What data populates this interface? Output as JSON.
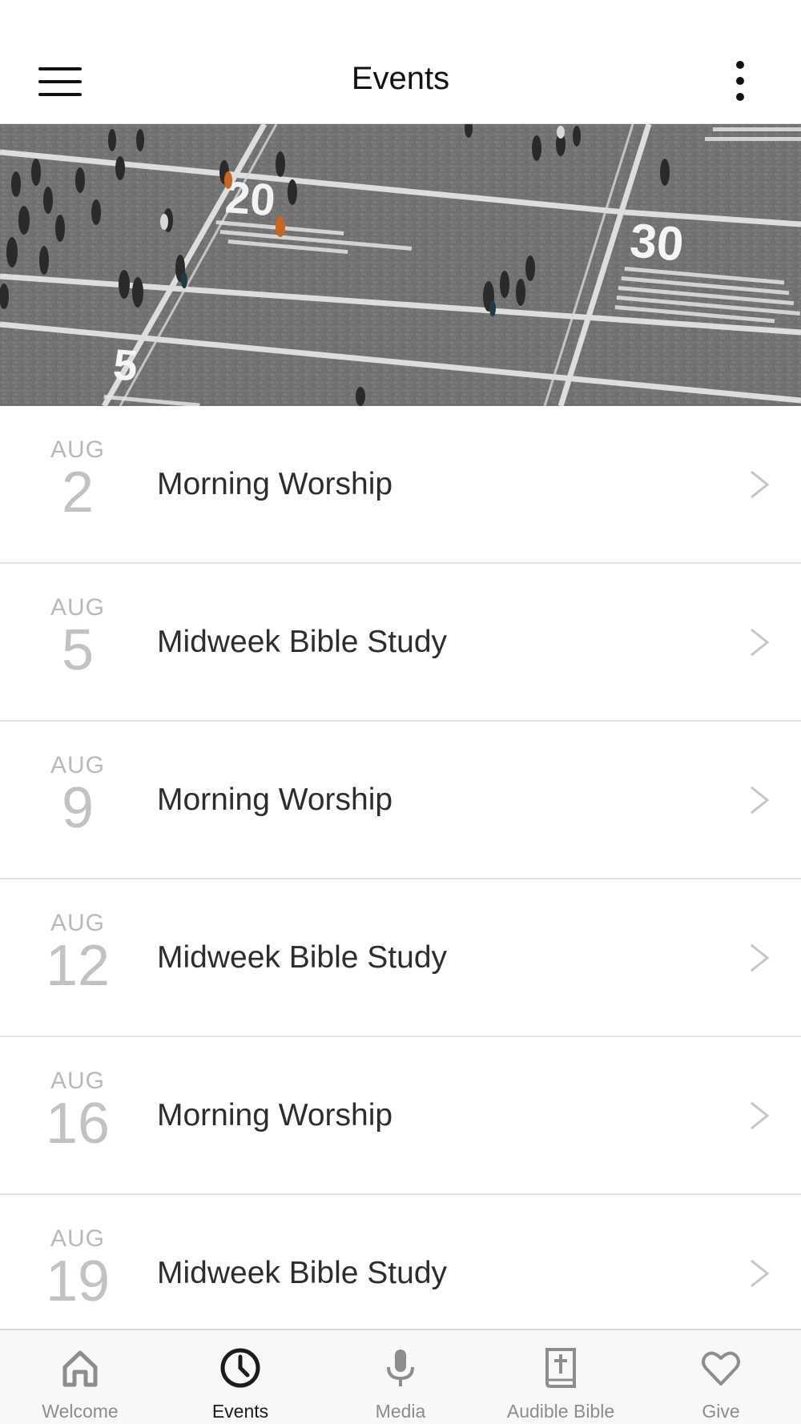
{
  "header": {
    "title": "Events",
    "menu_icon": "hamburger-menu-icon",
    "more_icon": "more-vertical-icon"
  },
  "banner": {
    "image": "aerial-crowd-plaza-photo",
    "painted_numbers": [
      "20",
      "30",
      "5"
    ]
  },
  "events": [
    {
      "month": "AUG",
      "day": "2",
      "title": "Morning Worship"
    },
    {
      "month": "AUG",
      "day": "5",
      "title": "Midweek Bible Study"
    },
    {
      "month": "AUG",
      "day": "9",
      "title": "Morning Worship"
    },
    {
      "month": "AUG",
      "day": "12",
      "title": "Midweek Bible Study"
    },
    {
      "month": "AUG",
      "day": "16",
      "title": "Morning Worship"
    },
    {
      "month": "AUG",
      "day": "19",
      "title": "Midweek Bible Study"
    }
  ],
  "tabs": [
    {
      "label": "Welcome",
      "icon": "home-icon",
      "active": false
    },
    {
      "label": "Events",
      "icon": "clock-icon",
      "active": true
    },
    {
      "label": "Media",
      "icon": "microphone-icon",
      "active": false
    },
    {
      "label": "Audible Bible",
      "icon": "bible-icon",
      "active": false
    },
    {
      "label": "Give",
      "icon": "heart-icon",
      "active": false
    }
  ],
  "colors": {
    "active_tab": "#1b1b1b",
    "inactive_tab": "#8d8d8d",
    "date_text": "#c2c2c2",
    "divider": "#e4e4e4"
  }
}
